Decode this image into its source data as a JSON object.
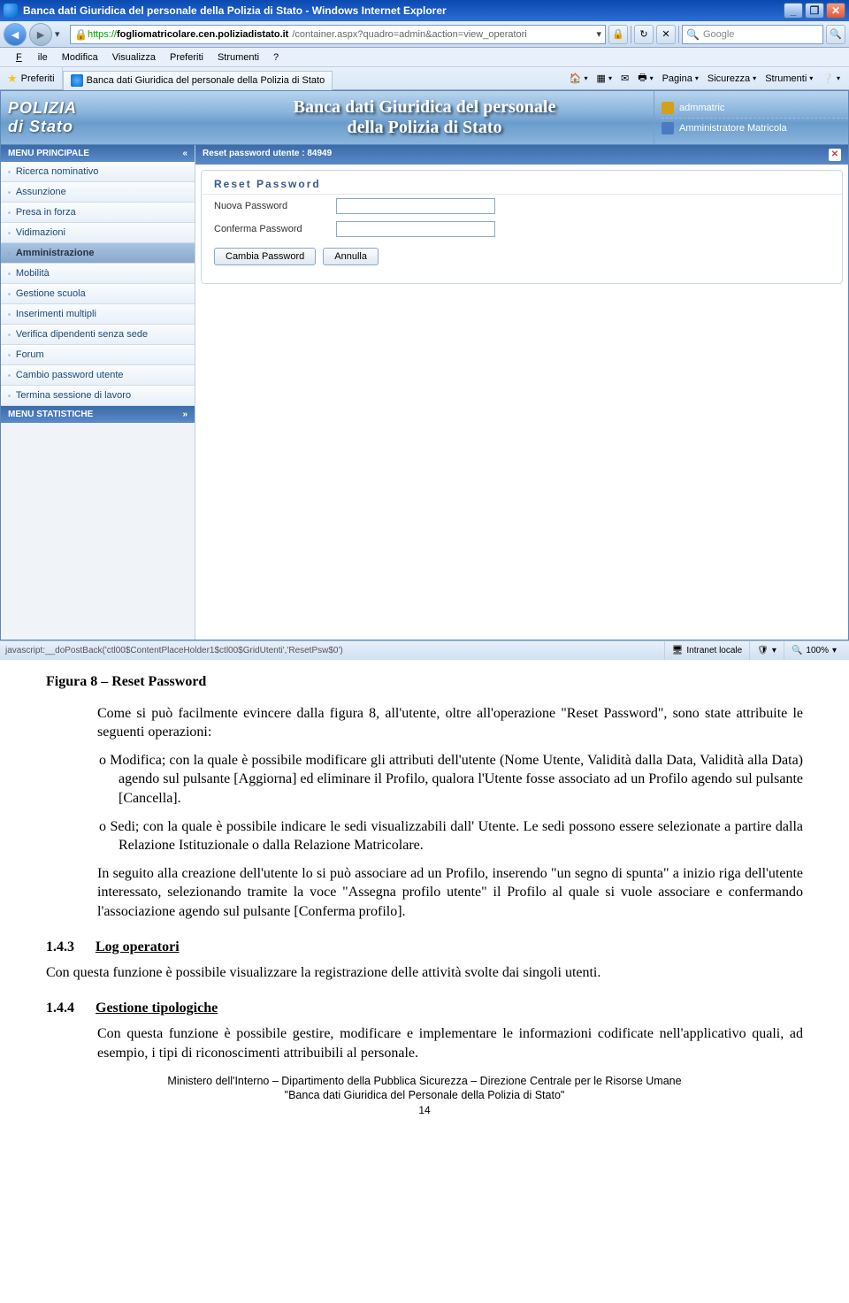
{
  "window": {
    "title": "Banca dati Giuridica del personale della Polizia di Stato - Windows Internet Explorer",
    "url_prefix": "https://",
    "url_host": "fogliomatricolare.cen.poliziadistato.it",
    "url_path": "/container.aspx?quadro=admin&action=view_operatori",
    "search_placeholder": "Google"
  },
  "menubar": {
    "file": "File",
    "modifica": "Modifica",
    "visualizza": "Visualizza",
    "preferiti": "Preferiti",
    "strumenti": "Strumenti",
    "help": "?"
  },
  "toolbar2": {
    "favorites": "Preferiti",
    "tab_title": "Banca dati Giuridica del personale della Polizia di Stato",
    "pagina": "Pagina",
    "sicurezza": "Sicurezza",
    "strumenti": "Strumenti"
  },
  "app": {
    "logo": "POLIZIA",
    "logo_sub": "di Stato",
    "title_line1": "Banca dati Giuridica del personale",
    "title_line2": "della Polizia di Stato",
    "username": "admmatric",
    "role": "Amministratore Matricola"
  },
  "sidebar": {
    "header_main": "MENU PRINCIPALE",
    "header_stats": "MENU STATISTICHE",
    "items": [
      "Ricerca nominativo",
      "Assunzione",
      "Presa in forza",
      "Vidimazioni",
      "Amministrazione",
      "Mobilità",
      "Gestione scuola",
      "Inserimenti multipli",
      "Verifica dipendenti senza sede",
      "Forum",
      "Cambio password utente",
      "Termina sessione di lavoro"
    ]
  },
  "content": {
    "header": "Reset password utente : 84949",
    "legend": "Reset Password",
    "label_new": "Nuova Password",
    "label_confirm": "Conferma Password",
    "btn_change": "Cambia Password",
    "btn_cancel": "Annulla"
  },
  "statusbar": {
    "js": "javascript:__doPostBack('ctl00$ContentPlaceHolder1$ctl00$GridUtenti','ResetPsw$0')",
    "zone": "Intranet locale",
    "zoom": "100%"
  },
  "doc": {
    "caption": "Figura 8 – Reset Password",
    "p1": "Come si può facilmente evincere dalla figura 8, all'utente, oltre all'operazione \"Reset Password\", sono state attribuite le seguenti operazioni:",
    "li1": "Modifica; con la quale è possibile modificare gli attributi dell'utente (Nome Utente, Validità dalla Data, Validità alla Data) agendo sul pulsante [Aggiorna] ed eliminare il Profilo, qualora l'Utente fosse associato ad un Profilo agendo sul pulsante [Cancella].",
    "li2": "Sedi; con la quale è possibile indicare le sedi visualizzabili dall' Utente. Le sedi possono essere selezionate a partire dalla Relazione Istituzionale o dalla Relazione Matricolare.",
    "p2": "In seguito alla creazione dell'utente lo si può associare ad un Profilo, inserendo \"un segno di spunta\" a inizio riga dell'utente interessato, selezionando tramite la voce \"Assegna profilo utente\" il Profilo al quale si vuole associare e confermando l'associazione agendo sul pulsante [Conferma profilo].",
    "h3a_num": "1.4.3",
    "h3a_txt": "Log operatori",
    "p3": "Con questa funzione è possibile visualizzare la registrazione delle attività svolte dai singoli utenti.",
    "h3b_num": "1.4.4",
    "h3b_txt": "Gestione tipologiche",
    "p4": "Con questa funzione è possibile gestire, modificare e implementare le informazioni codificate nell'applicativo quali, ad esempio, i tipi di riconoscimenti attribuibili al personale.",
    "footer1": "Ministero dell'Interno – Dipartimento della Pubblica Sicurezza – Direzione Centrale per le Risorse Umane",
    "footer2": "\"Banca dati Giuridica del Personale della Polizia di Stato\"",
    "page": "14"
  }
}
